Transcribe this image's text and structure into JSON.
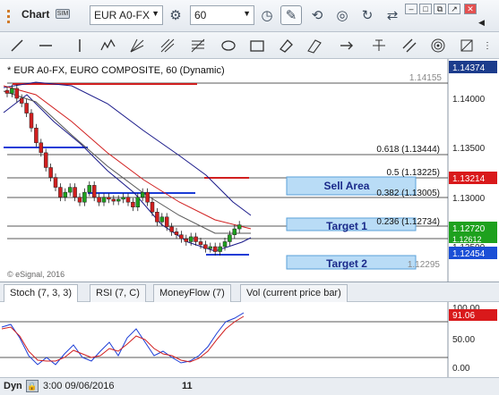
{
  "toolbar": {
    "window_title": "Chart",
    "pin_label": "SIM",
    "symbol": "EUR A0-FX",
    "interval": "60"
  },
  "chart": {
    "header": "* EUR A0-FX, EURO COMPOSITE, 60 (Dynamic)",
    "watermark": "© eSignal, 2016",
    "price_axis": [
      "1.14000",
      "1.13500",
      "1.13000",
      "1.12500"
    ],
    "last_price_badge": "1.14374",
    "high_label": "1.14155",
    "low_label": "1.12295",
    "price_badges": {
      "red": "1.13214",
      "green": "1.12720",
      "green_hidden": "1.12612",
      "blue": "1.12454"
    },
    "fib_levels": [
      {
        "label": "0.618 (1.13444)",
        "price": 1.13444
      },
      {
        "label": "0.5 (1.13225)",
        "price": 1.13225
      },
      {
        "label": "0.382 (1.13005)",
        "price": 1.13005
      },
      {
        "label": "0.236 (1.12734)",
        "price": 1.12734
      }
    ],
    "zones": [
      "Sell Area",
      "Target 1",
      "Target 2"
    ],
    "colors": {
      "up": "#1ea11e",
      "down": "#d11f1f",
      "price_badge": "#1c3c8c",
      "red_badge": "#d9191b",
      "green_badge": "#1ea11e",
      "blue_badge": "#1b4fd6",
      "zone_fill": "#b9dcf6"
    }
  },
  "indicator_tabs": [
    "Stoch (7, 3, 3)",
    "RSI (7, C)",
    "MoneyFlow (7)",
    "Vol (current price bar)"
  ],
  "stoch": {
    "axis": [
      "100.00",
      "50.00",
      "0.00"
    ],
    "value_badge": "91.06",
    "colors": {
      "k_line": "#1b3cd6",
      "d_line": "#d11f1f"
    }
  },
  "statusbar": {
    "label": "Dyn",
    "datetime": "3:00 09/06/2016",
    "date_tick": "11"
  }
}
